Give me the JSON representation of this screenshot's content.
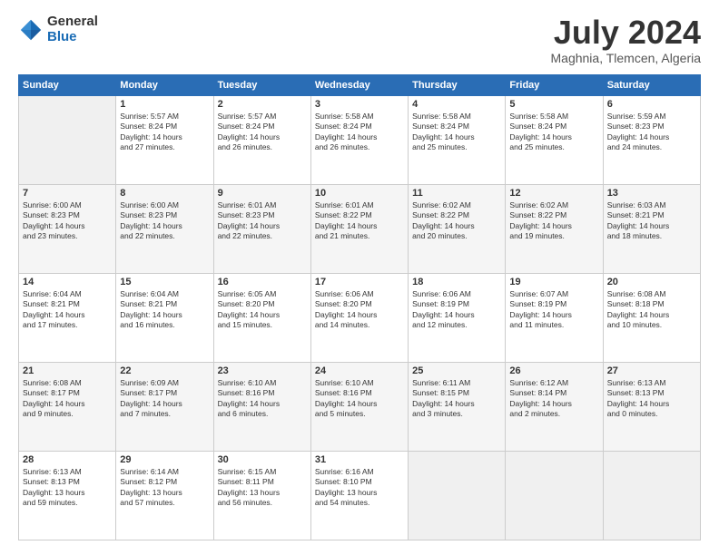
{
  "logo": {
    "general": "General",
    "blue": "Blue"
  },
  "header": {
    "title": "July 2024",
    "location": "Maghnia, Tlemcen, Algeria"
  },
  "weekdays": [
    "Sunday",
    "Monday",
    "Tuesday",
    "Wednesday",
    "Thursday",
    "Friday",
    "Saturday"
  ],
  "weeks": [
    [
      {
        "day": "",
        "info": ""
      },
      {
        "day": "1",
        "info": "Sunrise: 5:57 AM\nSunset: 8:24 PM\nDaylight: 14 hours\nand 27 minutes."
      },
      {
        "day": "2",
        "info": "Sunrise: 5:57 AM\nSunset: 8:24 PM\nDaylight: 14 hours\nand 26 minutes."
      },
      {
        "day": "3",
        "info": "Sunrise: 5:58 AM\nSunset: 8:24 PM\nDaylight: 14 hours\nand 26 minutes."
      },
      {
        "day": "4",
        "info": "Sunrise: 5:58 AM\nSunset: 8:24 PM\nDaylight: 14 hours\nand 25 minutes."
      },
      {
        "day": "5",
        "info": "Sunrise: 5:58 AM\nSunset: 8:24 PM\nDaylight: 14 hours\nand 25 minutes."
      },
      {
        "day": "6",
        "info": "Sunrise: 5:59 AM\nSunset: 8:23 PM\nDaylight: 14 hours\nand 24 minutes."
      }
    ],
    [
      {
        "day": "7",
        "info": "Sunrise: 6:00 AM\nSunset: 8:23 PM\nDaylight: 14 hours\nand 23 minutes."
      },
      {
        "day": "8",
        "info": "Sunrise: 6:00 AM\nSunset: 8:23 PM\nDaylight: 14 hours\nand 22 minutes."
      },
      {
        "day": "9",
        "info": "Sunrise: 6:01 AM\nSunset: 8:23 PM\nDaylight: 14 hours\nand 22 minutes."
      },
      {
        "day": "10",
        "info": "Sunrise: 6:01 AM\nSunset: 8:22 PM\nDaylight: 14 hours\nand 21 minutes."
      },
      {
        "day": "11",
        "info": "Sunrise: 6:02 AM\nSunset: 8:22 PM\nDaylight: 14 hours\nand 20 minutes."
      },
      {
        "day": "12",
        "info": "Sunrise: 6:02 AM\nSunset: 8:22 PM\nDaylight: 14 hours\nand 19 minutes."
      },
      {
        "day": "13",
        "info": "Sunrise: 6:03 AM\nSunset: 8:21 PM\nDaylight: 14 hours\nand 18 minutes."
      }
    ],
    [
      {
        "day": "14",
        "info": "Sunrise: 6:04 AM\nSunset: 8:21 PM\nDaylight: 14 hours\nand 17 minutes."
      },
      {
        "day": "15",
        "info": "Sunrise: 6:04 AM\nSunset: 8:21 PM\nDaylight: 14 hours\nand 16 minutes."
      },
      {
        "day": "16",
        "info": "Sunrise: 6:05 AM\nSunset: 8:20 PM\nDaylight: 14 hours\nand 15 minutes."
      },
      {
        "day": "17",
        "info": "Sunrise: 6:06 AM\nSunset: 8:20 PM\nDaylight: 14 hours\nand 14 minutes."
      },
      {
        "day": "18",
        "info": "Sunrise: 6:06 AM\nSunset: 8:19 PM\nDaylight: 14 hours\nand 12 minutes."
      },
      {
        "day": "19",
        "info": "Sunrise: 6:07 AM\nSunset: 8:19 PM\nDaylight: 14 hours\nand 11 minutes."
      },
      {
        "day": "20",
        "info": "Sunrise: 6:08 AM\nSunset: 8:18 PM\nDaylight: 14 hours\nand 10 minutes."
      }
    ],
    [
      {
        "day": "21",
        "info": "Sunrise: 6:08 AM\nSunset: 8:17 PM\nDaylight: 14 hours\nand 9 minutes."
      },
      {
        "day": "22",
        "info": "Sunrise: 6:09 AM\nSunset: 8:17 PM\nDaylight: 14 hours\nand 7 minutes."
      },
      {
        "day": "23",
        "info": "Sunrise: 6:10 AM\nSunset: 8:16 PM\nDaylight: 14 hours\nand 6 minutes."
      },
      {
        "day": "24",
        "info": "Sunrise: 6:10 AM\nSunset: 8:16 PM\nDaylight: 14 hours\nand 5 minutes."
      },
      {
        "day": "25",
        "info": "Sunrise: 6:11 AM\nSunset: 8:15 PM\nDaylight: 14 hours\nand 3 minutes."
      },
      {
        "day": "26",
        "info": "Sunrise: 6:12 AM\nSunset: 8:14 PM\nDaylight: 14 hours\nand 2 minutes."
      },
      {
        "day": "27",
        "info": "Sunrise: 6:13 AM\nSunset: 8:13 PM\nDaylight: 14 hours\nand 0 minutes."
      }
    ],
    [
      {
        "day": "28",
        "info": "Sunrise: 6:13 AM\nSunset: 8:13 PM\nDaylight: 13 hours\nand 59 minutes."
      },
      {
        "day": "29",
        "info": "Sunrise: 6:14 AM\nSunset: 8:12 PM\nDaylight: 13 hours\nand 57 minutes."
      },
      {
        "day": "30",
        "info": "Sunrise: 6:15 AM\nSunset: 8:11 PM\nDaylight: 13 hours\nand 56 minutes."
      },
      {
        "day": "31",
        "info": "Sunrise: 6:16 AM\nSunset: 8:10 PM\nDaylight: 13 hours\nand 54 minutes."
      },
      {
        "day": "",
        "info": ""
      },
      {
        "day": "",
        "info": ""
      },
      {
        "day": "",
        "info": ""
      }
    ]
  ]
}
